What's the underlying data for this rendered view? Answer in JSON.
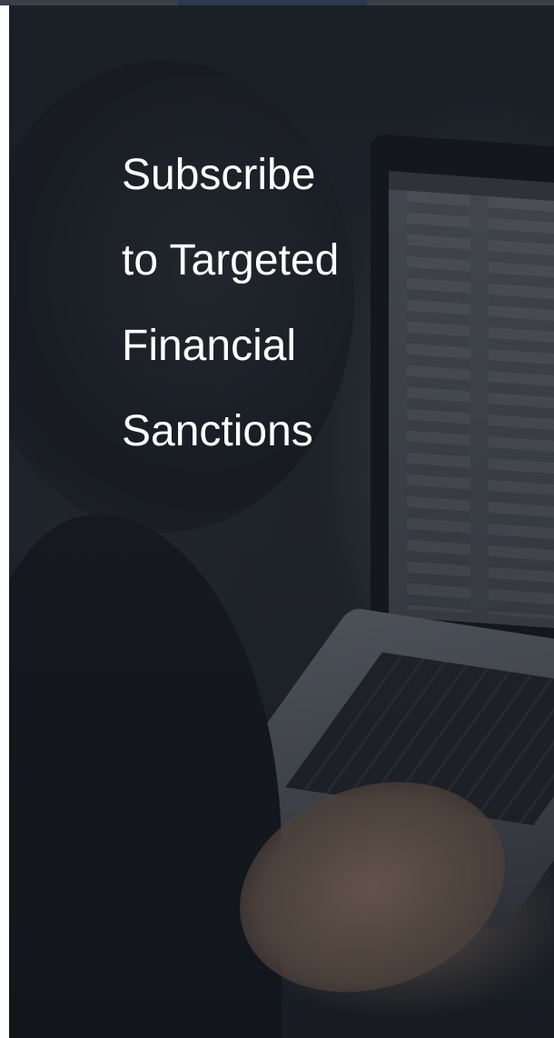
{
  "hero": {
    "headline_lines": [
      "Subscribe",
      "to Targeted",
      "Financial",
      "Sanctions"
    ]
  },
  "colors": {
    "headline_text": "#ffffff",
    "background_dark": "#1f242c"
  }
}
